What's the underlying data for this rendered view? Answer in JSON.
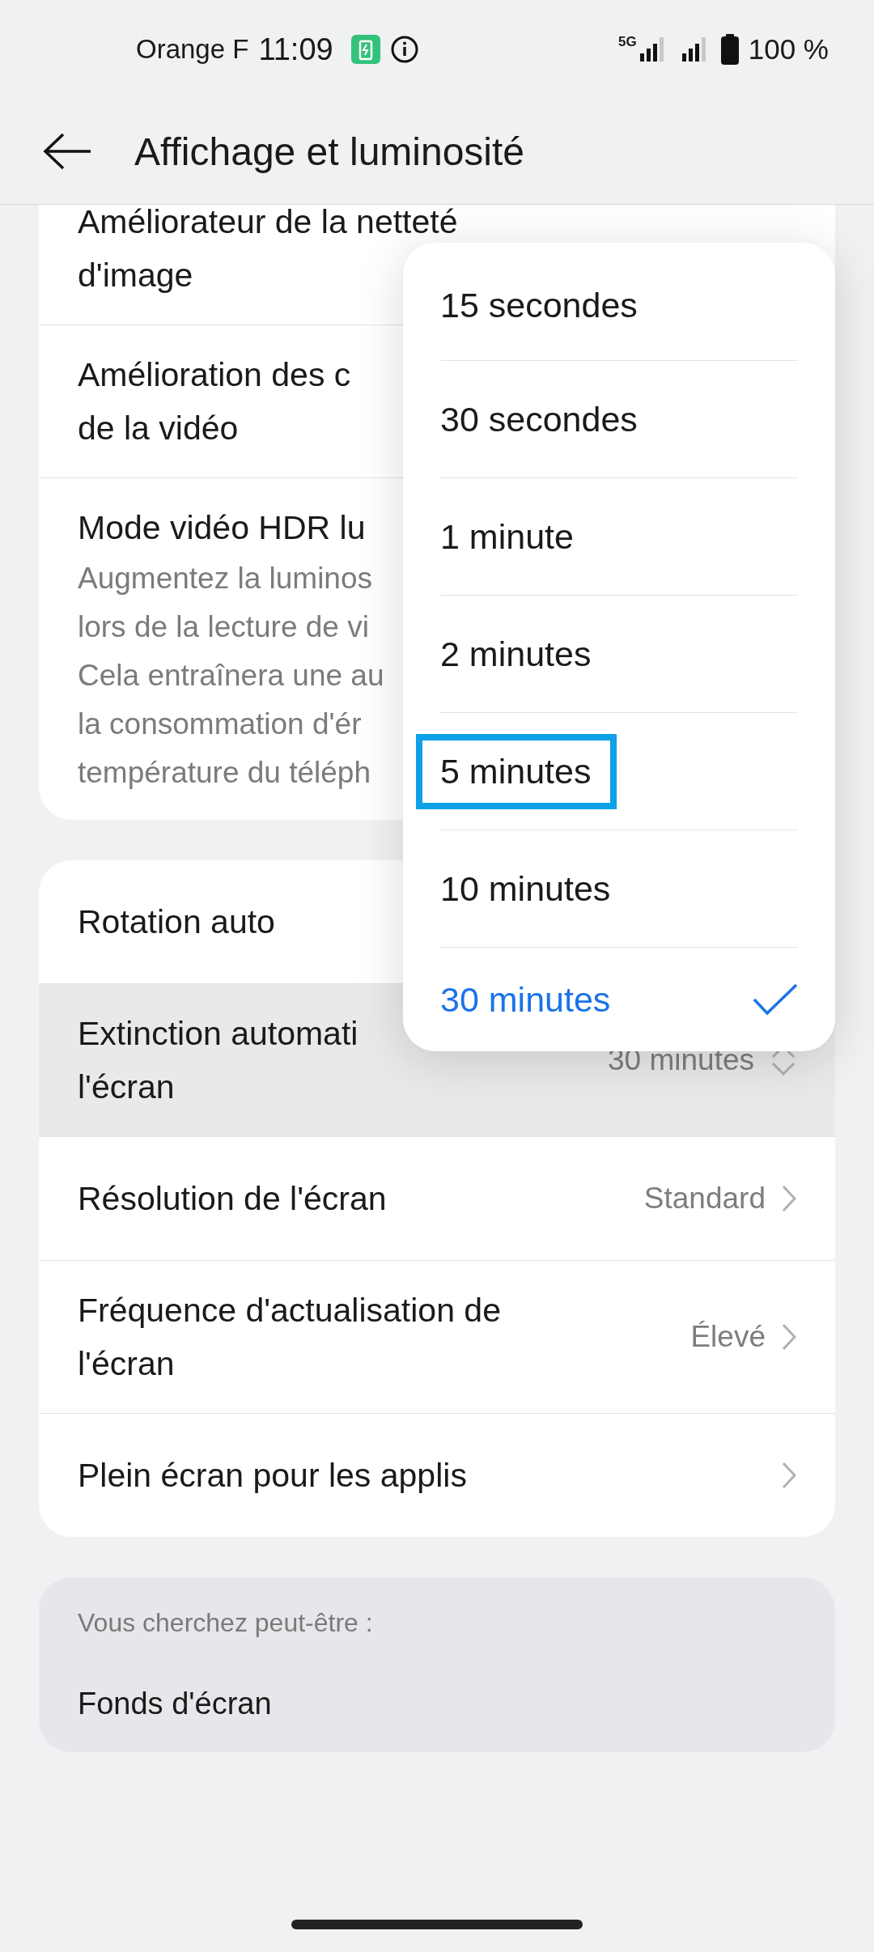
{
  "status_bar": {
    "carrier": "Orange F",
    "time": "11:09",
    "network": "5G",
    "battery": "100 %"
  },
  "header": {
    "title": "Affichage et luminosité"
  },
  "groups": [
    {
      "kind": "card",
      "rows": [
        {
          "title": "Améliorateur de la netteté\nd'image",
          "kind": "plain"
        },
        {
          "title": "Amélioration des c\nde la vidéo",
          "kind": "plain"
        },
        {
          "title": "Mode vidéo HDR lu",
          "kind": "plain",
          "description": "Augmentez la luminos\nlors de la lecture de vi\nCela entraînera une au\nla consommation d'ér\ntempérature du téléph"
        }
      ]
    },
    {
      "kind": "card",
      "rows": [
        {
          "title": "Rotation auto",
          "kind": "plain",
          "pressed": false
        },
        {
          "title": "Extinction automati\nl'écran",
          "value": "30 minutes",
          "kind": "stepper",
          "pressed": true
        },
        {
          "title": "Résolution de l'écran",
          "value": "Standard",
          "kind": "chevron",
          "pressed": false
        },
        {
          "title": "Fréquence d'actualisation de\nl'écran",
          "value": "Élevé",
          "kind": "chevron",
          "pressed": false
        },
        {
          "title": "Plein écran pour les applis",
          "kind": "chevron",
          "pressed": false
        }
      ]
    },
    {
      "kind": "suggestions",
      "heading": "Vous cherchez peut-être :",
      "rows": [
        {
          "title": "Fonds d'écran"
        }
      ]
    }
  ],
  "popup": {
    "options": [
      {
        "label": "15 secondes",
        "selected": false,
        "highlighted": false
      },
      {
        "label": "30 secondes",
        "selected": false,
        "highlighted": false
      },
      {
        "label": "1 minute",
        "selected": false,
        "highlighted": false
      },
      {
        "label": "2 minutes",
        "selected": false,
        "highlighted": false
      },
      {
        "label": "5 minutes",
        "selected": false,
        "highlighted": true
      },
      {
        "label": "10 minutes",
        "selected": false,
        "highlighted": false
      },
      {
        "label": "30 minutes",
        "selected": true,
        "highlighted": false
      }
    ]
  }
}
